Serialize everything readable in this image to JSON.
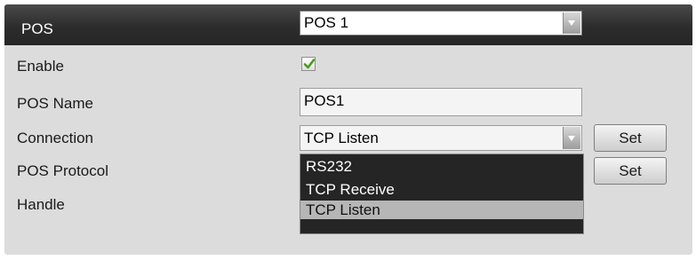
{
  "header": {
    "label": "POS",
    "pos_select_value": "POS 1"
  },
  "fields": {
    "enable_label": "Enable",
    "enable_checked": true,
    "pos_name_label": "POS Name",
    "pos_name_value": "POS1",
    "connection_label": "Connection",
    "connection_value": "TCP Listen",
    "pos_protocol_label": "POS Protocol",
    "handle_label": "Handle"
  },
  "buttons": {
    "connection_set": "Set",
    "protocol_set": "Set"
  },
  "dropdown": {
    "options": [
      "RS232",
      "TCP Receive",
      "TCP Listen"
    ],
    "selected": "TCP Listen"
  },
  "icons": {
    "checkbox": "check-icon",
    "dropdown_arrow": "chevron-down-icon"
  }
}
